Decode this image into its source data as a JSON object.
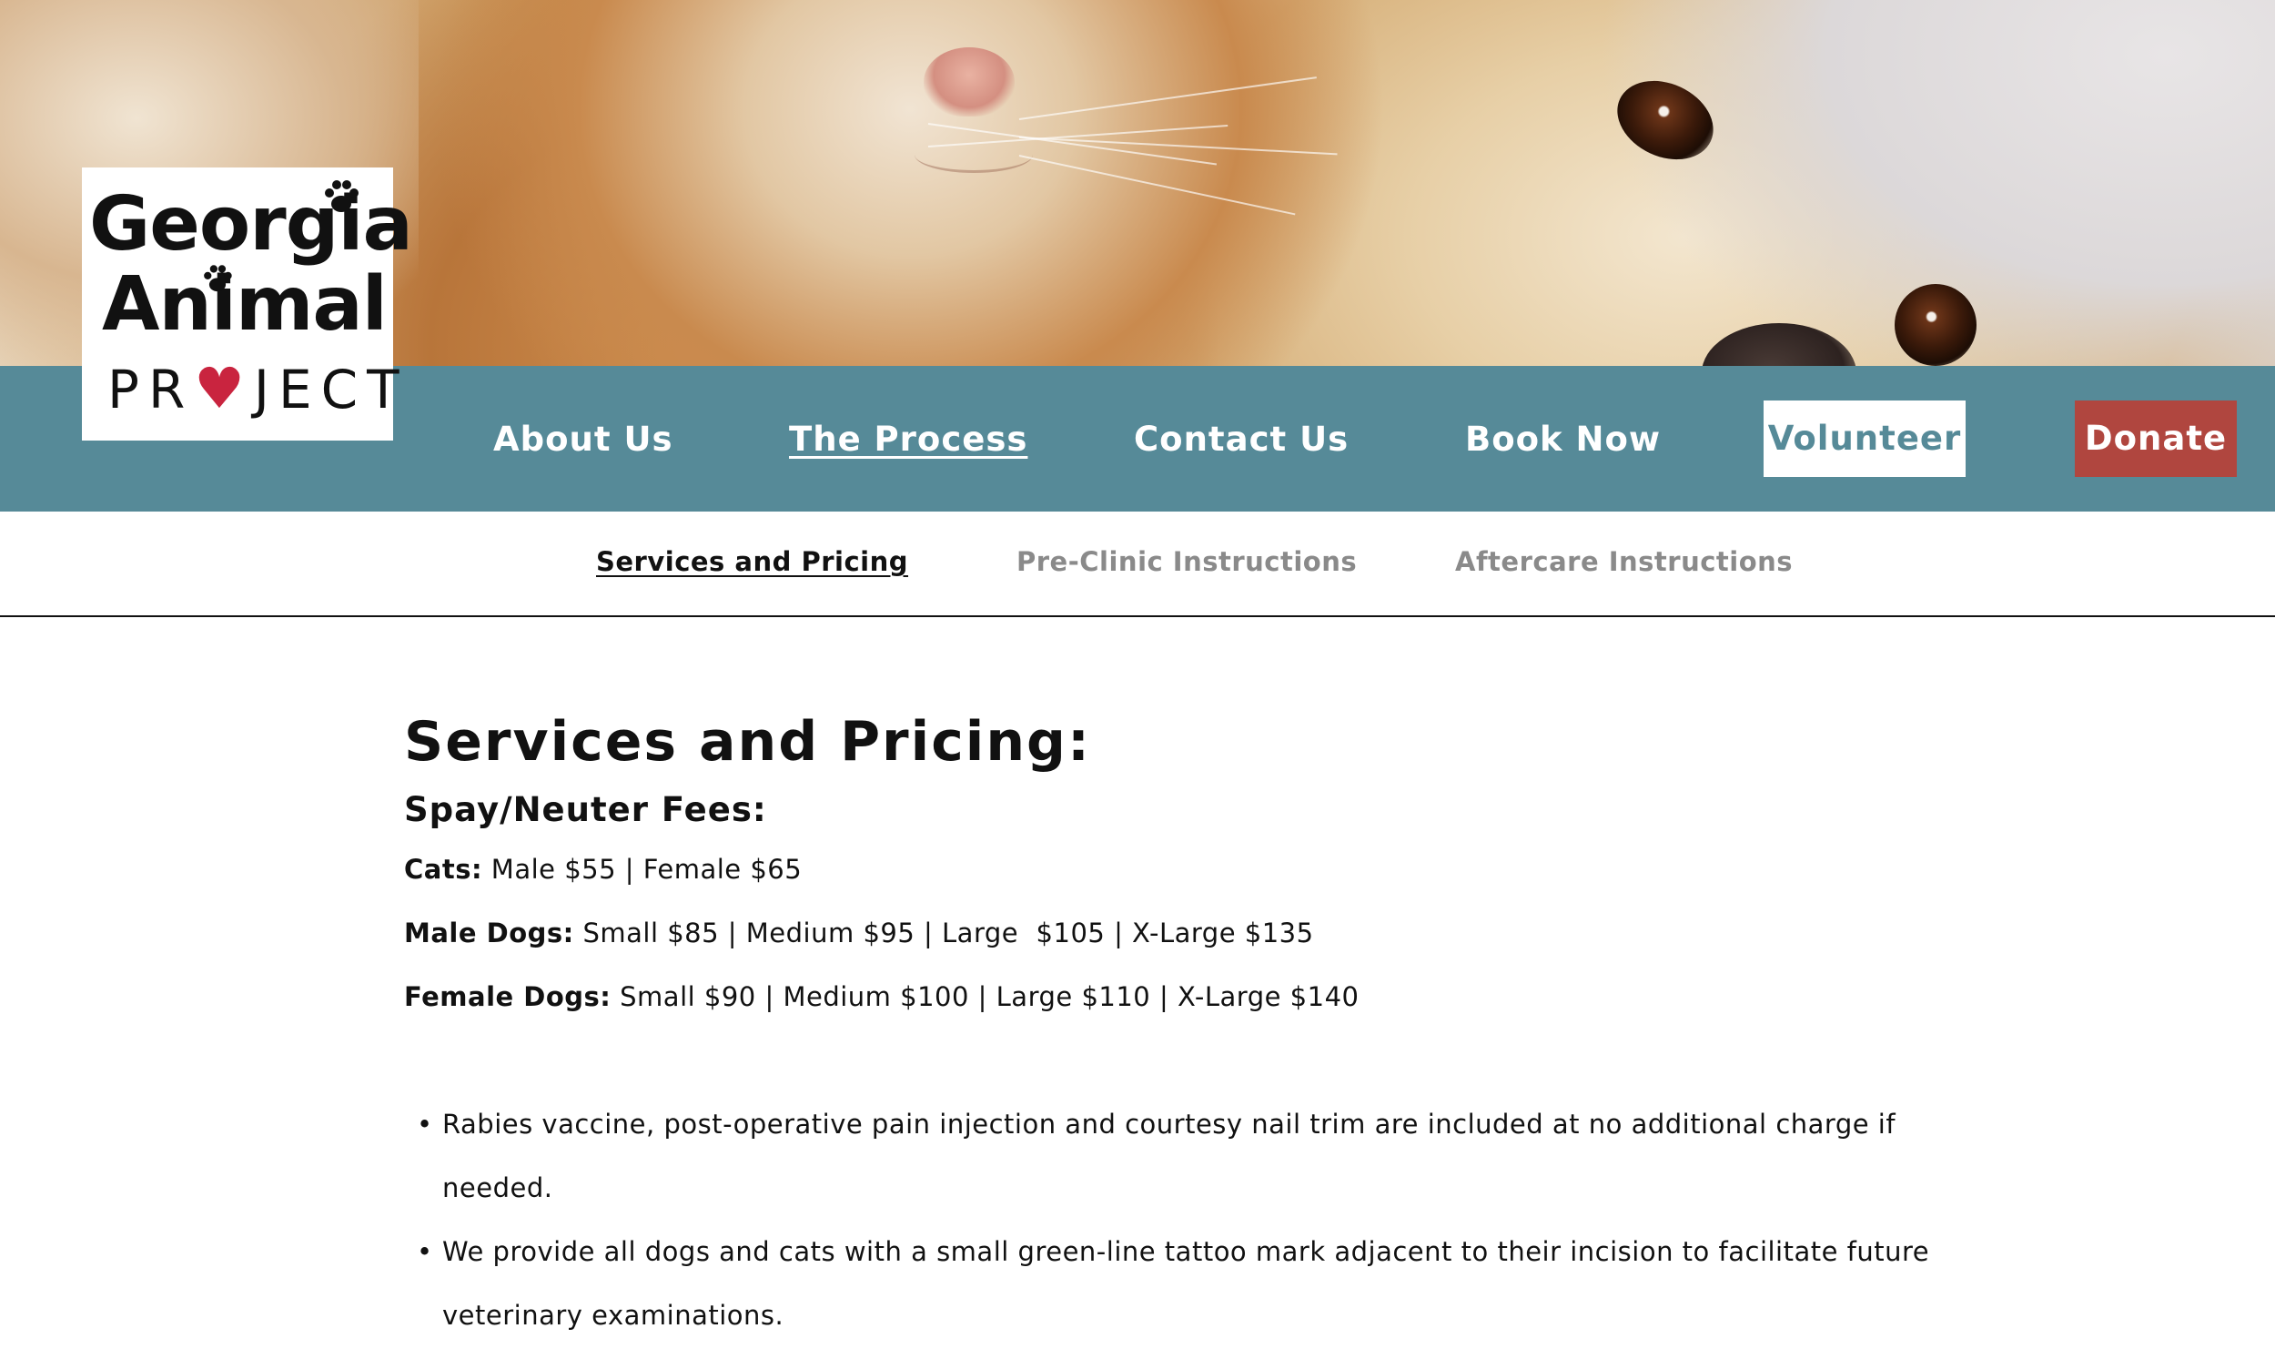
{
  "logo": {
    "line1": "Georgia",
    "line2": "Animal",
    "line3_pre": "PR",
    "line3_heart": "♥",
    "line3_post": "JECT"
  },
  "nav": {
    "items": [
      {
        "label": "About Us",
        "active": false
      },
      {
        "label": "The Process",
        "active": true
      },
      {
        "label": "Contact Us",
        "active": false
      },
      {
        "label": "Book Now",
        "active": false
      }
    ],
    "volunteer_label": "Volunteer",
    "donate_label": "Donate"
  },
  "subnav": {
    "items": [
      {
        "label": "Services and Pricing",
        "active": true
      },
      {
        "label": "Pre-Clinic Instructions",
        "active": false
      },
      {
        "label": "Aftercare Instructions",
        "active": false
      }
    ]
  },
  "content": {
    "title": "Services and Pricing:",
    "subtitle": "Spay/Neuter Fees:",
    "fees": [
      {
        "label": "Cats:",
        "text": "Male $55 | Female $65"
      },
      {
        "label": "Male Dogs:",
        "text": "Small $85 | Medium $95 | Large  $105 | X-Large $135"
      },
      {
        "label": "Female Dogs:",
        "text": "Small $90 | Medium $100 | Large $110 | X-Large $140"
      }
    ],
    "bullets": [
      "Rabies vaccine, post-operative pain injection and courtesy nail trim are included at no additional charge if needed.",
      "We provide all dogs and cats with a small green-line tattoo mark adjacent to their incision to facilitate future veterinary examinations."
    ]
  },
  "colors": {
    "nav_bg": "#568a98",
    "donate_bg": "#b0463f",
    "volunteer_bg": "#ffffff",
    "heart": "#c9243f",
    "subnav_inactive": "#8a8a8a"
  },
  "icons": {
    "paw": "paw-print-icon",
    "heart": "heart-icon"
  }
}
